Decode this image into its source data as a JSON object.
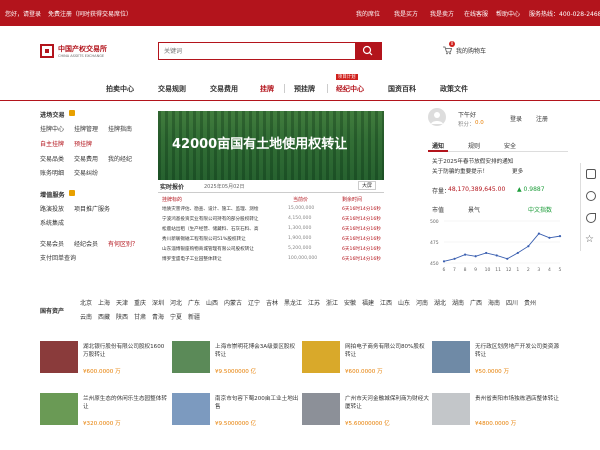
{
  "topbar": {
    "greeting": "您好，请登录",
    "register": "免费注册（同时获得交易席位）",
    "links": [
      "我的席位",
      "我是买方",
      "我是卖方",
      "在线客服",
      "帮助中心"
    ],
    "hotline": "服务热线：400-028-2468"
  },
  "logo": {
    "cn": "中国产权交易所",
    "en": "CHINA ASSETS EXCHANGE"
  },
  "search": {
    "placeholder": "关键词"
  },
  "cart": {
    "label": "我的购物车",
    "count": "0"
  },
  "nav": {
    "items": [
      "拍卖中心",
      "交易规则",
      "交易费用",
      "挂牌",
      "预挂牌",
      "经纪中心",
      "国资百科",
      "政策文件"
    ],
    "badge": "项目计划"
  },
  "left_menu": {
    "section1": "进场交易",
    "s1_links": [
      "挂牌中心",
      "挂牌管理",
      "挂牌指南",
      "自主挂牌",
      "预挂牌",
      "交易品类",
      "交易费用",
      "我的经纪",
      "账务明细",
      "交易纠纷"
    ],
    "section2": "增值服务",
    "s2_links": [
      "路演投放",
      "项目推广服务",
      "系统集成"
    ],
    "s3_links": [
      "交易会员",
      "经纪会员",
      "有何区别？",
      "支付回单查询"
    ]
  },
  "banner": {
    "text": "42000亩国有土地使用权转让"
  },
  "quote": {
    "title": "实时报价",
    "date": "2025年05月02日",
    "toggle": "大屏",
    "headers": [
      "挂牌标的",
      "当前价",
      "剩余时间"
    ],
    "rows": [
      {
        "name": "地质灾害评估、勘查、设计、施工、监理、测绘",
        "price": "15,000,000",
        "time": "6天16时14分16秒"
      },
      {
        "name": "宁波鸿基投资实业有限公司持有的部分股权转让",
        "price": "4,150,000",
        "time": "6天16时14分16秒"
      },
      {
        "name": "松鹿站出租（生产经营、储藏料、石灰石料、高",
        "price": "1,300,000",
        "time": "6天16时14分16秒"
      },
      {
        "name": "秀川新联锡磁工程有限公司51%股权转让",
        "price": "1,900,000",
        "time": "6天16时14分16秒"
      },
      {
        "name": "山东淄博银座购物商城管理有限公司股权转让",
        "price": "5,200,000",
        "time": "6天16时14分16秒"
      },
      {
        "name": "博罗宝盛电子工业园整体转让",
        "price": "100,000,000",
        "time": "6天16时14分16秒"
      }
    ]
  },
  "user": {
    "greeting": "下午好",
    "points_label": "积分：",
    "points": "0.0",
    "login": "登录",
    "register": "注册"
  },
  "notice": {
    "tabs": [
      "通知",
      "规则",
      "安全"
    ],
    "items": [
      "关于2025年春节放假安排的通知",
      "关于防骗的重要提示！"
    ],
    "more": "更多"
  },
  "market": {
    "label": "存量：",
    "value": "48,170,389,645.00",
    "change": "▲ 0.9887"
  },
  "chart_tabs": [
    "市值",
    "景气",
    "中文指数"
  ],
  "chart_data": {
    "type": "line",
    "categories": [
      "6",
      "7",
      "8",
      "9",
      "10",
      "11",
      "12",
      "1",
      "2",
      "3",
      "4",
      "5"
    ],
    "values": [
      452,
      455,
      460,
      458,
      462,
      459,
      455,
      462,
      470,
      485,
      480,
      482
    ],
    "ylim": [
      450,
      500
    ],
    "yticks": [
      450,
      475,
      500
    ],
    "color": "#3a5fb0"
  },
  "regions": {
    "label": "国有资产",
    "row1": [
      "北京",
      "上海",
      "天津",
      "重庆",
      "深圳",
      "河北",
      "广东",
      "山西",
      "内蒙古",
      "辽宁",
      "吉林",
      "黑龙江",
      "江苏",
      "浙江",
      "安徽",
      "福建",
      "江西",
      "山东",
      "河南",
      "湖北",
      "湖南",
      "广西",
      "海南",
      "四川",
      "贵州"
    ],
    "row2": [
      "云南",
      "西藏",
      "陕西",
      "甘肃",
      "青海",
      "宁夏",
      "新疆"
    ]
  },
  "listings": [
    {
      "title": "湖北银行股份有限公司股权1600万股转让",
      "price": "¥600.0000 万"
    },
    {
      "title": "上海市崇明花博会3A级景区股权转让",
      "price": "¥9.5000000 亿"
    },
    {
      "title": "网拍电子商务有限公司80%股权转让",
      "price": "¥600.0000 万"
    },
    {
      "title": "无行政区划房地产开发公司类资源转让",
      "price": "¥50.0000 万"
    },
    {
      "title": "兰州原生态的休闲乐生态园整体转让",
      "price": "¥320.0000 万"
    },
    {
      "title": "南京市句容下蜀200亩工业土地出售",
      "price": "¥9.5000000 亿"
    },
    {
      "title": "广州市天河金融城保利商为财经大厦转让",
      "price": "¥5.60000000 亿"
    },
    {
      "title": "贵州省贵阳市场独栋酒店整体转让",
      "price": "¥4800.0000 万"
    }
  ]
}
